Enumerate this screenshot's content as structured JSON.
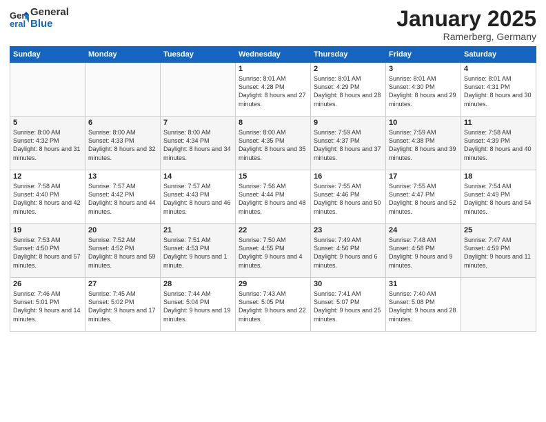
{
  "logo": {
    "general": "General",
    "blue": "Blue"
  },
  "title": "January 2025",
  "location": "Ramerberg, Germany",
  "days_header": [
    "Sunday",
    "Monday",
    "Tuesday",
    "Wednesday",
    "Thursday",
    "Friday",
    "Saturday"
  ],
  "weeks": [
    [
      {
        "day": "",
        "text": ""
      },
      {
        "day": "",
        "text": ""
      },
      {
        "day": "",
        "text": ""
      },
      {
        "day": "1",
        "text": "Sunrise: 8:01 AM\nSunset: 4:28 PM\nDaylight: 8 hours\nand 27 minutes."
      },
      {
        "day": "2",
        "text": "Sunrise: 8:01 AM\nSunset: 4:29 PM\nDaylight: 8 hours\nand 28 minutes."
      },
      {
        "day": "3",
        "text": "Sunrise: 8:01 AM\nSunset: 4:30 PM\nDaylight: 8 hours\nand 29 minutes."
      },
      {
        "day": "4",
        "text": "Sunrise: 8:01 AM\nSunset: 4:31 PM\nDaylight: 8 hours\nand 30 minutes."
      }
    ],
    [
      {
        "day": "5",
        "text": "Sunrise: 8:00 AM\nSunset: 4:32 PM\nDaylight: 8 hours\nand 31 minutes."
      },
      {
        "day": "6",
        "text": "Sunrise: 8:00 AM\nSunset: 4:33 PM\nDaylight: 8 hours\nand 32 minutes."
      },
      {
        "day": "7",
        "text": "Sunrise: 8:00 AM\nSunset: 4:34 PM\nDaylight: 8 hours\nand 34 minutes."
      },
      {
        "day": "8",
        "text": "Sunrise: 8:00 AM\nSunset: 4:35 PM\nDaylight: 8 hours\nand 35 minutes."
      },
      {
        "day": "9",
        "text": "Sunrise: 7:59 AM\nSunset: 4:37 PM\nDaylight: 8 hours\nand 37 minutes."
      },
      {
        "day": "10",
        "text": "Sunrise: 7:59 AM\nSunset: 4:38 PM\nDaylight: 8 hours\nand 39 minutes."
      },
      {
        "day": "11",
        "text": "Sunrise: 7:58 AM\nSunset: 4:39 PM\nDaylight: 8 hours\nand 40 minutes."
      }
    ],
    [
      {
        "day": "12",
        "text": "Sunrise: 7:58 AM\nSunset: 4:40 PM\nDaylight: 8 hours\nand 42 minutes."
      },
      {
        "day": "13",
        "text": "Sunrise: 7:57 AM\nSunset: 4:42 PM\nDaylight: 8 hours\nand 44 minutes."
      },
      {
        "day": "14",
        "text": "Sunrise: 7:57 AM\nSunset: 4:43 PM\nDaylight: 8 hours\nand 46 minutes."
      },
      {
        "day": "15",
        "text": "Sunrise: 7:56 AM\nSunset: 4:44 PM\nDaylight: 8 hours\nand 48 minutes."
      },
      {
        "day": "16",
        "text": "Sunrise: 7:55 AM\nSunset: 4:46 PM\nDaylight: 8 hours\nand 50 minutes."
      },
      {
        "day": "17",
        "text": "Sunrise: 7:55 AM\nSunset: 4:47 PM\nDaylight: 8 hours\nand 52 minutes."
      },
      {
        "day": "18",
        "text": "Sunrise: 7:54 AM\nSunset: 4:49 PM\nDaylight: 8 hours\nand 54 minutes."
      }
    ],
    [
      {
        "day": "19",
        "text": "Sunrise: 7:53 AM\nSunset: 4:50 PM\nDaylight: 8 hours\nand 57 minutes."
      },
      {
        "day": "20",
        "text": "Sunrise: 7:52 AM\nSunset: 4:52 PM\nDaylight: 8 hours\nand 59 minutes."
      },
      {
        "day": "21",
        "text": "Sunrise: 7:51 AM\nSunset: 4:53 PM\nDaylight: 9 hours\nand 1 minute."
      },
      {
        "day": "22",
        "text": "Sunrise: 7:50 AM\nSunset: 4:55 PM\nDaylight: 9 hours\nand 4 minutes."
      },
      {
        "day": "23",
        "text": "Sunrise: 7:49 AM\nSunset: 4:56 PM\nDaylight: 9 hours\nand 6 minutes."
      },
      {
        "day": "24",
        "text": "Sunrise: 7:48 AM\nSunset: 4:58 PM\nDaylight: 9 hours\nand 9 minutes."
      },
      {
        "day": "25",
        "text": "Sunrise: 7:47 AM\nSunset: 4:59 PM\nDaylight: 9 hours\nand 11 minutes."
      }
    ],
    [
      {
        "day": "26",
        "text": "Sunrise: 7:46 AM\nSunset: 5:01 PM\nDaylight: 9 hours\nand 14 minutes."
      },
      {
        "day": "27",
        "text": "Sunrise: 7:45 AM\nSunset: 5:02 PM\nDaylight: 9 hours\nand 17 minutes."
      },
      {
        "day": "28",
        "text": "Sunrise: 7:44 AM\nSunset: 5:04 PM\nDaylight: 9 hours\nand 19 minutes."
      },
      {
        "day": "29",
        "text": "Sunrise: 7:43 AM\nSunset: 5:05 PM\nDaylight: 9 hours\nand 22 minutes."
      },
      {
        "day": "30",
        "text": "Sunrise: 7:41 AM\nSunset: 5:07 PM\nDaylight: 9 hours\nand 25 minutes."
      },
      {
        "day": "31",
        "text": "Sunrise: 7:40 AM\nSunset: 5:08 PM\nDaylight: 9 hours\nand 28 minutes."
      },
      {
        "day": "",
        "text": ""
      }
    ]
  ]
}
